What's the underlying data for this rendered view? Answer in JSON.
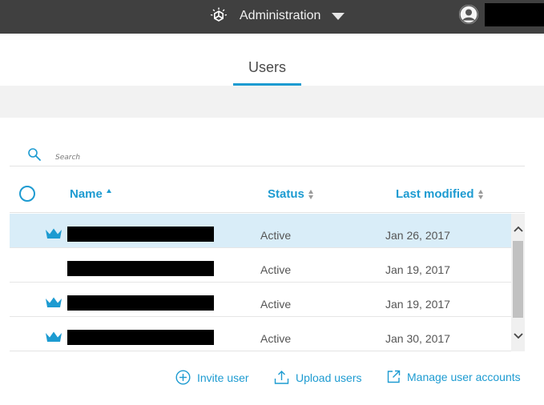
{
  "header": {
    "app_title": "Administration",
    "logo_icon": "ibm-logo-icon",
    "avatar_icon": "user-avatar-icon"
  },
  "tabs": [
    {
      "label": "Users",
      "active": true
    }
  ],
  "search": {
    "placeholder": "Search",
    "value": ""
  },
  "table": {
    "columns": [
      {
        "label": "Name",
        "sort": "ascending"
      },
      {
        "label": "Status",
        "sort": "sortable"
      },
      {
        "label": "Last modified",
        "sort": "sortable"
      }
    ],
    "rows": [
      {
        "admin": true,
        "status": "Active",
        "last_modified": "Jan 26, 2017",
        "selected": true
      },
      {
        "admin": false,
        "status": "Active",
        "last_modified": "Jan 19, 2017",
        "selected": false
      },
      {
        "admin": true,
        "status": "Active",
        "last_modified": "Jan 19, 2017",
        "selected": false
      },
      {
        "admin": true,
        "status": "Active",
        "last_modified": "Jan 30, 2017",
        "selected": false
      }
    ]
  },
  "actions": {
    "invite_label": "Invite user",
    "upload_label": "Upload users",
    "manage_label": "Manage user accounts"
  },
  "colors": {
    "topbar": "#404040",
    "accent": "#1d9bd1",
    "selected_row": "#d9edf8",
    "band": "#f2f2f2"
  }
}
